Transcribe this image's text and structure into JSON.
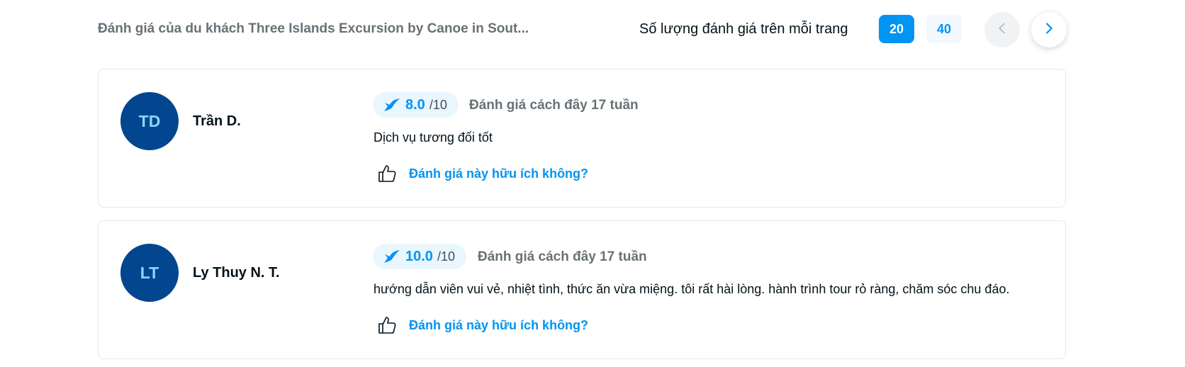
{
  "header": {
    "title": "Đánh giá của du khách Three Islands Excursion by Canoe in Sout...",
    "per_page_label": "Số lượng đánh giá trên mỗi trang",
    "per_page_options": [
      "20",
      "40"
    ],
    "selected_per_page": "20",
    "prev_icon": "chevron-left-icon",
    "next_icon": "chevron-right-icon"
  },
  "reviews": [
    {
      "initials": "TD",
      "name": "Trần D.",
      "score": "8.0",
      "score_max": "/10",
      "time": "Đánh giá cách đây 17 tuần",
      "text": "Dịch vụ tương đối tốt",
      "helpful_label": "Đánh giá này hữu ích không?"
    },
    {
      "initials": "LT",
      "name": "Ly Thuy N. T.",
      "score": "10.0",
      "score_max": "/10",
      "time": "Đánh giá cách đây 17 tuần",
      "text": "hướng dẫn viên vui vẻ, nhiệt tình, thức ăn vừa miệng. tôi rất hài lòng. hành trình tour rỏ ràng, chăm sóc chu đáo.",
      "helpful_label": "Đánh giá này hữu ích không?"
    }
  ],
  "colors": {
    "accent": "#0194f3",
    "avatar_bg": "#01468e",
    "avatar_text": "#8fd2ff",
    "pill_bg": "#eaf6fe",
    "muted_text": "#687176"
  }
}
